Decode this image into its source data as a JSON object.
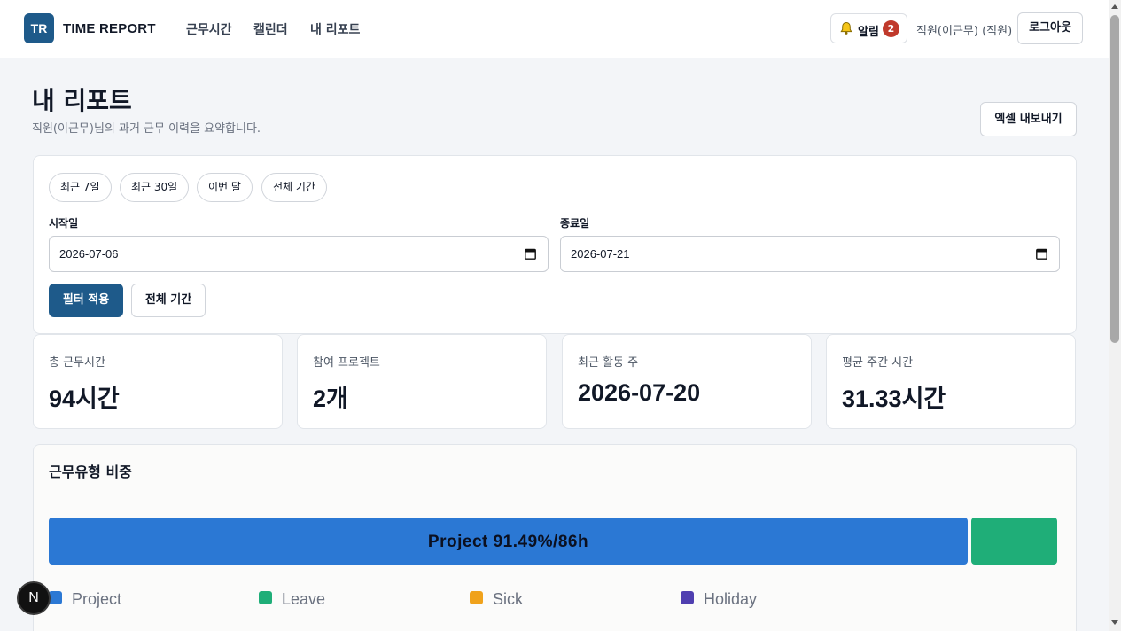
{
  "brand": {
    "logo_text": "TR",
    "name": "TIME REPORT"
  },
  "nav": {
    "items": [
      {
        "label": "근무시간"
      },
      {
        "label": "캘린더"
      },
      {
        "label": "내 리포트"
      }
    ]
  },
  "header_right": {
    "bell_label": "알림",
    "bell_count": "2",
    "user": "직원(이근무) (직원)",
    "logout": "로그아웃"
  },
  "page": {
    "title": "내 리포트",
    "subtitle": "직원(이근무)님의 과거 근무 이력을 요약합니다.",
    "export": "엑셀 내보내기"
  },
  "filter": {
    "chips": [
      "최근 7일",
      "최근 30일",
      "이번 달",
      "전체 기간"
    ],
    "start_label": "시작일",
    "start_value": "2026-07-06",
    "end_label": "종료일",
    "end_value": "2026-07-21",
    "apply": "필터 적용",
    "all_period": "전체 기간"
  },
  "stats": [
    {
      "label": "총 근무시간",
      "value": "94시간"
    },
    {
      "label": "참여 프로젝트",
      "value": "2개"
    },
    {
      "label": "최근 활동 주",
      "value": "2026-07-20"
    },
    {
      "label": "평균 주간 시간",
      "value": "31.33시간"
    }
  ],
  "work_type": {
    "title": "근무유형 비중",
    "segments": [
      {
        "name": "Project",
        "share": 91.49,
        "label": "Project 91.49%/86h",
        "color": "#2b78d4"
      },
      {
        "name": "Leave",
        "share": 8.51,
        "label": "",
        "color": "#1fae78"
      }
    ],
    "legend": [
      {
        "name": "Project",
        "color": "#2b78d4"
      },
      {
        "name": "Leave",
        "color": "#1fae78"
      },
      {
        "name": "Sick",
        "color": "#f0a21b"
      },
      {
        "name": "Holiday",
        "color": "#4f3fb0"
      }
    ]
  },
  "floating": {
    "label": "N"
  },
  "colors": {
    "primary": "#1e5a8a",
    "badge": "#c0392b"
  }
}
